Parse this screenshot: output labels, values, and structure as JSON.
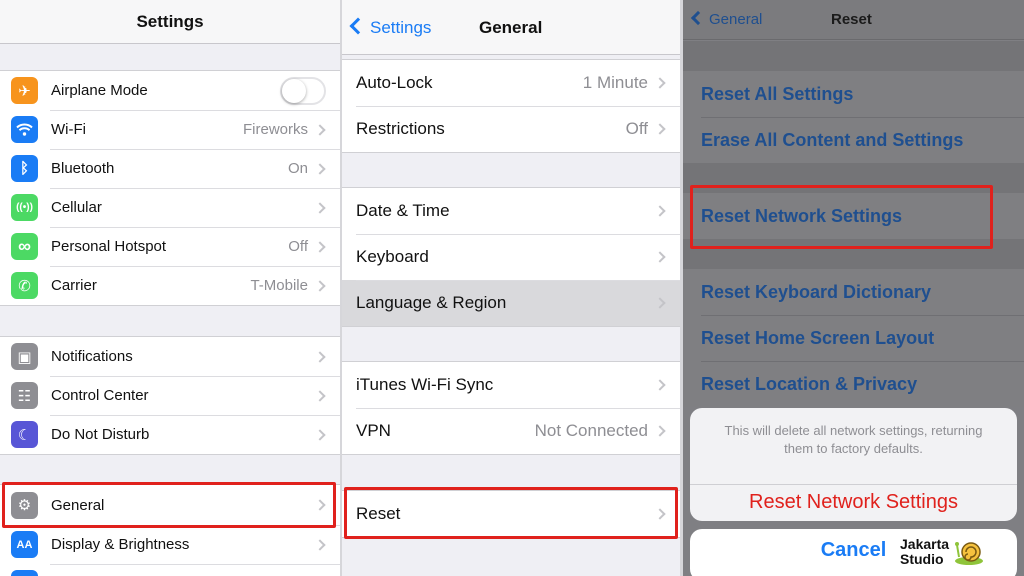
{
  "left_panel": {
    "title": "Settings",
    "group1": [
      {
        "label": "Airplane Mode",
        "value": "",
        "icon": "airplane-icon",
        "color": "#f7941d",
        "glyph": "✈"
      },
      {
        "label": "Wi-Fi",
        "value": "Fireworks",
        "icon": "wifi-icon",
        "color": "#1a7cf5",
        "glyph": "◠"
      },
      {
        "label": "Bluetooth",
        "value": "On",
        "icon": "bluetooth-icon",
        "color": "#1a7cf5",
        "glyph": "ᛒ"
      },
      {
        "label": "Cellular",
        "value": "",
        "icon": "cellular-icon",
        "color": "#4cd964",
        "glyph": "((•))"
      },
      {
        "label": "Personal Hotspot",
        "value": "Off",
        "icon": "hotspot-icon",
        "color": "#4cd964",
        "glyph": "∞"
      },
      {
        "label": "Carrier",
        "value": "T-Mobile",
        "icon": "phone-icon",
        "color": "#4cd964",
        "glyph": "✆"
      }
    ],
    "group2": [
      {
        "label": "Notifications",
        "value": "",
        "icon": "notifications-icon",
        "color": "#8e8e93",
        "glyph": "▣"
      },
      {
        "label": "Control Center",
        "value": "",
        "icon": "control-center-icon",
        "color": "#8e8e93",
        "glyph": "☷"
      },
      {
        "label": "Do Not Disturb",
        "value": "",
        "icon": "moon-icon",
        "color": "#5856d6",
        "glyph": "☾"
      }
    ],
    "group3": [
      {
        "label": "General",
        "value": "",
        "icon": "gear-icon",
        "color": "#8e8e93",
        "glyph": "⚙"
      },
      {
        "label": "Display & Brightness",
        "value": "",
        "icon": "display-icon",
        "color": "#1a7cf5",
        "glyph": "AA"
      },
      {
        "label": "",
        "value": "",
        "icon": "wallpaper-icon",
        "color": "#1a7cf5",
        "glyph": ""
      }
    ]
  },
  "middle_panel": {
    "back_label": "Settings",
    "title": "General",
    "group1": [
      {
        "label": "Auto-Lock",
        "value": "1 Minute"
      },
      {
        "label": "Restrictions",
        "value": "Off"
      }
    ],
    "group2": [
      {
        "label": "Date & Time",
        "value": ""
      },
      {
        "label": "Keyboard",
        "value": ""
      },
      {
        "label": "Language & Region",
        "value": ""
      }
    ],
    "group3": [
      {
        "label": "iTunes Wi-Fi Sync",
        "value": ""
      },
      {
        "label": "VPN",
        "value": "Not Connected"
      }
    ],
    "group4": [
      {
        "label": "Reset",
        "value": ""
      }
    ]
  },
  "right_panel": {
    "back_label": "General",
    "title": "Reset",
    "group1": [
      "Reset All Settings",
      "Erase All Content and Settings"
    ],
    "group2": [
      "Reset Network Settings"
    ],
    "group3": [
      "Reset Keyboard Dictionary",
      "Reset Home Screen Layout",
      "Reset Location & Privacy"
    ],
    "sheet": {
      "message": "This will delete all network settings, returning them to factory defaults.",
      "confirm": "Reset Network Settings",
      "cancel": "Cancel"
    }
  },
  "watermark": {
    "line1": "Jakarta",
    "line2": "Studio"
  },
  "colors": {
    "accent": "#1a7cf5",
    "highlight": "#e0211c",
    "destructive": "#e0211c"
  }
}
